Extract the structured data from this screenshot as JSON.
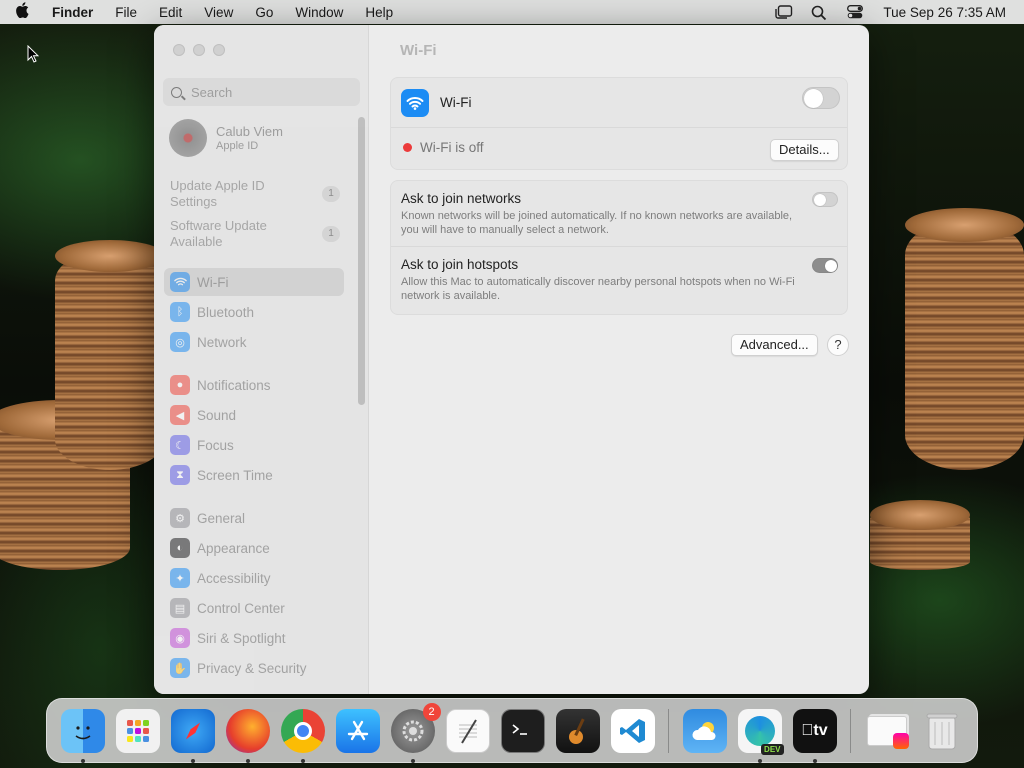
{
  "menubar": {
    "app_name": "Finder",
    "menus": [
      "File",
      "Edit",
      "View",
      "Go",
      "Window",
      "Help"
    ],
    "clock": "Tue Sep 26  7:35 AM"
  },
  "window": {
    "search_placeholder": "Search",
    "profile": {
      "name": "Calub Viem",
      "subtitle": "Apple ID"
    },
    "notices": [
      {
        "label": "Update Apple ID Settings",
        "count": "1"
      },
      {
        "label": "Software Update Available",
        "count": "1"
      }
    ],
    "sidebar_items": [
      {
        "label": "Wi-Fi",
        "icon": "wifi-icon",
        "color": "#1c8cf4"
      },
      {
        "label": "Bluetooth",
        "icon": "bluetooth-icon",
        "color": "#1c8cf4"
      },
      {
        "label": "Network",
        "icon": "globe-icon",
        "color": "#1c8cf4"
      },
      {
        "label": "Notifications",
        "icon": "bell-icon",
        "color": "#f0453a"
      },
      {
        "label": "Sound",
        "icon": "speaker-icon",
        "color": "#f0453a"
      },
      {
        "label": "Focus",
        "icon": "moon-icon",
        "color": "#5e5ce6"
      },
      {
        "label": "Screen Time",
        "icon": "hourglass-icon",
        "color": "#5e5ce6"
      },
      {
        "label": "General",
        "icon": "gear-icon",
        "color": "#8e8e93"
      },
      {
        "label": "Appearance",
        "icon": "appearance-icon",
        "color": "#1c1c1e"
      },
      {
        "label": "Accessibility",
        "icon": "accessibility-icon",
        "color": "#1c8cf4"
      },
      {
        "label": "Control Center",
        "icon": "control-center-icon",
        "color": "#8e8e93"
      },
      {
        "label": "Siri & Spotlight",
        "icon": "siri-icon",
        "color": "#c04ad6"
      },
      {
        "label": "Privacy & Security",
        "icon": "hand-icon",
        "color": "#1c8cf4"
      }
    ],
    "main": {
      "title": "Wi-Fi",
      "wifi_label": "Wi-Fi",
      "wifi_enabled": false,
      "status": "Wi-Fi is off",
      "details_button": "Details...",
      "options": [
        {
          "title": "Ask to join networks",
          "desc": "Known networks will be joined automatically. If no known networks are available, you will have to manually select a network.",
          "enabled": false
        },
        {
          "title": "Ask to join hotspots",
          "desc": "Allow this Mac to automatically discover nearby personal hotspots when no Wi-Fi network is available.",
          "enabled": true
        }
      ],
      "advanced_button": "Advanced...",
      "help_button": "?"
    }
  },
  "dock": {
    "apps": [
      {
        "name": "Finder",
        "icon": "finder-icon",
        "running": true
      },
      {
        "name": "Launchpad",
        "icon": "launchpad-icon",
        "running": false
      },
      {
        "name": "Safari",
        "icon": "safari-icon",
        "running": true
      },
      {
        "name": "Firefox",
        "icon": "firefox-icon",
        "running": true
      },
      {
        "name": "Chrome",
        "icon": "chrome-icon",
        "running": true
      },
      {
        "name": "App Store",
        "icon": "app-store-icon",
        "running": false
      },
      {
        "name": "System Settings",
        "icon": "system-settings-icon",
        "running": true,
        "badge": "2"
      },
      {
        "name": "TextEdit",
        "icon": "textedit-icon",
        "running": false
      },
      {
        "name": "Terminal",
        "icon": "terminal-icon",
        "running": false
      },
      {
        "name": "GarageBand",
        "icon": "garageband-icon",
        "running": false
      },
      {
        "name": "Visual Studio Code",
        "icon": "vscode-icon",
        "running": false
      },
      {
        "name": "Weather",
        "icon": "weather-icon",
        "running": false
      },
      {
        "name": "Edge Dev",
        "icon": "edge-dev-icon",
        "running": true
      },
      {
        "name": "Apple TV",
        "icon": "apple-tv-icon",
        "running": true
      },
      {
        "name": "Downloads",
        "icon": "downloads-stack-icon",
        "running": false
      },
      {
        "name": "Trash",
        "icon": "trash-icon",
        "running": false
      }
    ],
    "dev_label": "DEV",
    "tv_label": "tv"
  }
}
